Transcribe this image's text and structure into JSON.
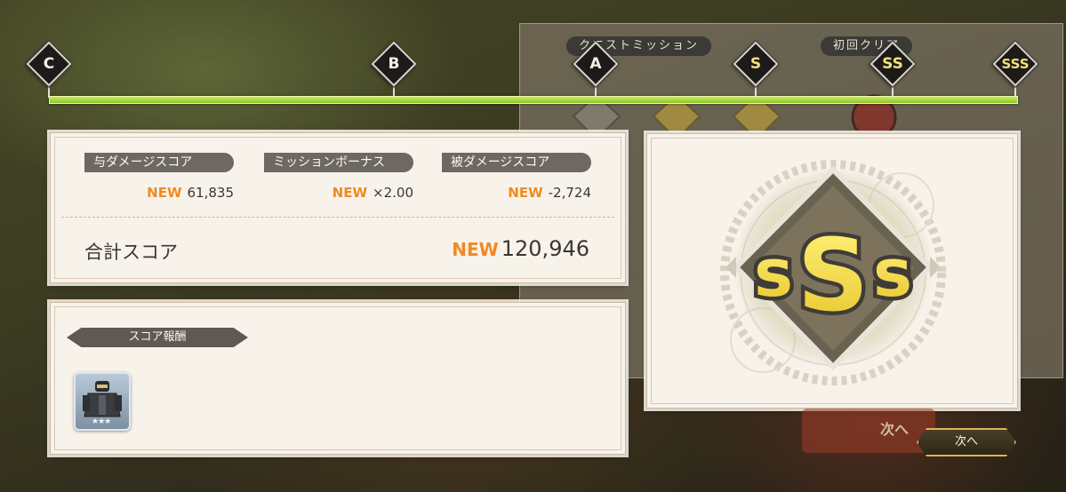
{
  "background_panel": {
    "quest_mission_label": "クエストミッション",
    "first_clear_label": "初回クリア"
  },
  "rank_track": {
    "ranks": [
      "C",
      "B",
      "A",
      "S",
      "SS",
      "SSS"
    ],
    "achieved": "SSS",
    "bar_color": "#b5e04a"
  },
  "score": {
    "damage_dealt": {
      "label": "与ダメージスコア",
      "badge": "NEW",
      "value": "61,835"
    },
    "mission_bonus": {
      "label": "ミッションボーナス",
      "badge": "NEW",
      "value": "×2.00"
    },
    "damage_taken": {
      "label": "被ダメージスコア",
      "badge": "NEW",
      "value": "-2,724"
    },
    "total": {
      "label": "合計スコア",
      "badge": "NEW",
      "value": "120,946"
    }
  },
  "reward": {
    "header": "スコア報酬",
    "item_icon": "armored-figure-icon",
    "item_stars": "★★★"
  },
  "rank_result": {
    "rank": "SSS"
  },
  "next": {
    "ghost_label": "次へ",
    "button_label": "次へ"
  },
  "colors": {
    "accent_new": "#f08a24",
    "panel_bg": "#f8f3ea",
    "button_border": "#d9b65a"
  }
}
